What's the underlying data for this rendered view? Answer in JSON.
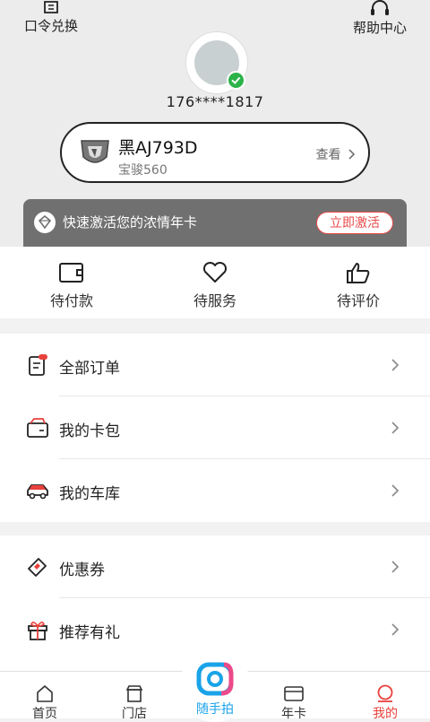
{
  "header": {
    "redeem_label": "口令兑换",
    "help_label": "帮助中心",
    "phone": "176****1817"
  },
  "car": {
    "plate": "黑AJ793D",
    "model": "宝骏560",
    "view_label": "查看"
  },
  "banner": {
    "text": "快速激活您的浓情年卡",
    "button_label": "立即激活"
  },
  "orders": [
    {
      "label": "待付款",
      "icon": "wallet-icon"
    },
    {
      "label": "待服务",
      "icon": "heart-icon"
    },
    {
      "label": "待评价",
      "icon": "thumbs-up-icon"
    }
  ],
  "menu_group1": [
    {
      "label": "全部订单",
      "icon": "order-list-icon"
    },
    {
      "label": "我的卡包",
      "icon": "card-wallet-icon"
    },
    {
      "label": "我的车库",
      "icon": "car-icon"
    }
  ],
  "menu_group2": [
    {
      "label": "优惠券",
      "icon": "coupon-icon"
    },
    {
      "label": "推荐有礼",
      "icon": "gift-icon"
    }
  ],
  "tabbar": {
    "home": "首页",
    "store": "门店",
    "camera": "随手拍",
    "annual_card": "年卡",
    "mine": "我的",
    "active_color": "#e8413c",
    "camera_color": "#1aa3e8"
  }
}
